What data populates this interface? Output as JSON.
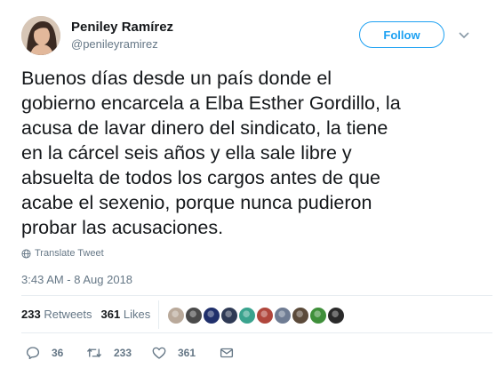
{
  "user": {
    "name": "Peniley Ramírez",
    "handle": "@penileyramirez"
  },
  "follow_label": "Follow",
  "tweet": {
    "lines": [
      "Buenos días desde un país donde el",
      "gobierno encarcela a Elba Esther Gordillo, la",
      "acusa de lavar dinero del sindicato, la tiene",
      "en la cárcel seis años y ella sale libre y",
      "absuelta de todos los cargos antes de que",
      "acabe el sexenio, porque nunca pudieron",
      "probar las acusaciones."
    ]
  },
  "translate_label": "Translate Tweet",
  "timestamp": "3:43 AM - 8 Aug 2018",
  "stats": {
    "retweets_count": "233",
    "retweets_label": "Retweets",
    "likes_count": "361",
    "likes_label": "Likes"
  },
  "likers": [
    {
      "icon": "avatar",
      "color": "#b9a99a"
    },
    {
      "icon": "avatar",
      "color": "#4a4a4a"
    },
    {
      "icon": "avatar",
      "color": "#1f2f6b"
    },
    {
      "icon": "avatar",
      "color": "#2f3a55"
    },
    {
      "icon": "avatar",
      "color": "#3aa38e"
    },
    {
      "icon": "avatar",
      "color": "#b0463c"
    },
    {
      "icon": "avatar",
      "color": "#6f7c93"
    },
    {
      "icon": "avatar",
      "color": "#5b4a3a"
    },
    {
      "icon": "avatar",
      "color": "#3f8f3a"
    },
    {
      "icon": "avatar",
      "color": "#2a2a2a"
    }
  ],
  "actions": {
    "reply_count": "36",
    "retweet_count": "233",
    "like_count": "361"
  },
  "colors": {
    "accent": "#1da1f2",
    "text": "#14171a",
    "muted": "#657786",
    "border": "#e6ecf0"
  }
}
